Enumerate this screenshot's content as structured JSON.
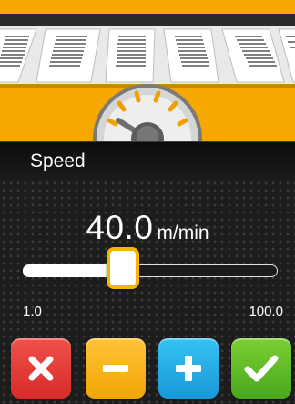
{
  "header": {
    "title": "Speed"
  },
  "speed": {
    "value": "40.0",
    "unit": "m/min",
    "min_label": "1.0",
    "max_label": "100.0",
    "min": 1.0,
    "max": 100.0,
    "current": 40.0
  },
  "buttons": {
    "cancel_icon": "close-icon",
    "decrease_icon": "minus-icon",
    "increase_icon": "plus-icon",
    "confirm_icon": "check-icon"
  },
  "colors": {
    "illustration_bg": "#f6a800",
    "cancel": "#e23b36",
    "decrease": "#f7b21c",
    "increase": "#25abe4",
    "confirm": "#62bd28",
    "thumb_border": "#f4b400"
  }
}
